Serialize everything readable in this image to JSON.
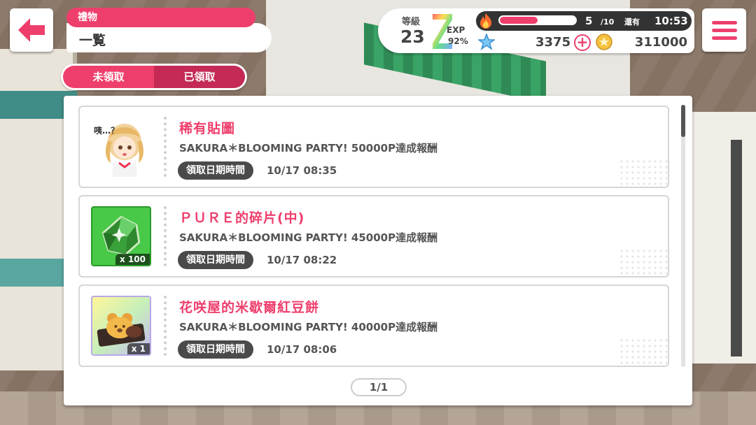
{
  "header": {
    "category": "禮物",
    "title": "一覧"
  },
  "status": {
    "level_label": "等級",
    "level": "23",
    "exp_label": "EXP",
    "exp_percent": "92%",
    "stamina_current": "5",
    "stamina_max": "/10",
    "stamina_fraction": 0.5,
    "remain_label": "還有",
    "remain_time": "10:53",
    "stars": "3375",
    "coins": "311000"
  },
  "tabs": [
    {
      "label": "未領取",
      "active": true
    },
    {
      "label": "已領取",
      "active": false
    }
  ],
  "gifts": [
    {
      "title": "稀有貼圖",
      "desc": "SAKURA＊BLOOMING PARTY! 50000P達成報酬",
      "date_label": "領取日期時間",
      "date": "10/17 08:35",
      "icon": "sticker-icon",
      "sticker_text": "咦…？",
      "qty": ""
    },
    {
      "title": "ＰＵＲＥ的碎片(中)",
      "desc": "SAKURA＊BLOOMING PARTY! 45000P達成報酬",
      "date_label": "領取日期時間",
      "date": "10/17 08:22",
      "icon": "pure-shard-icon",
      "qty": "x 100"
    },
    {
      "title": "花咲屋的米歇爾紅豆餅",
      "desc": "SAKURA＊BLOOMING PARTY! 40000P達成報酬",
      "date_label": "領取日期時間",
      "date": "10/17 08:06",
      "icon": "imagawayaki-icon",
      "qty": "x 1"
    }
  ],
  "pager": "1/1",
  "colors": {
    "accent": "#ee3f6c",
    "accent_dark": "#c42a55",
    "badge": "#4a4a4a"
  }
}
